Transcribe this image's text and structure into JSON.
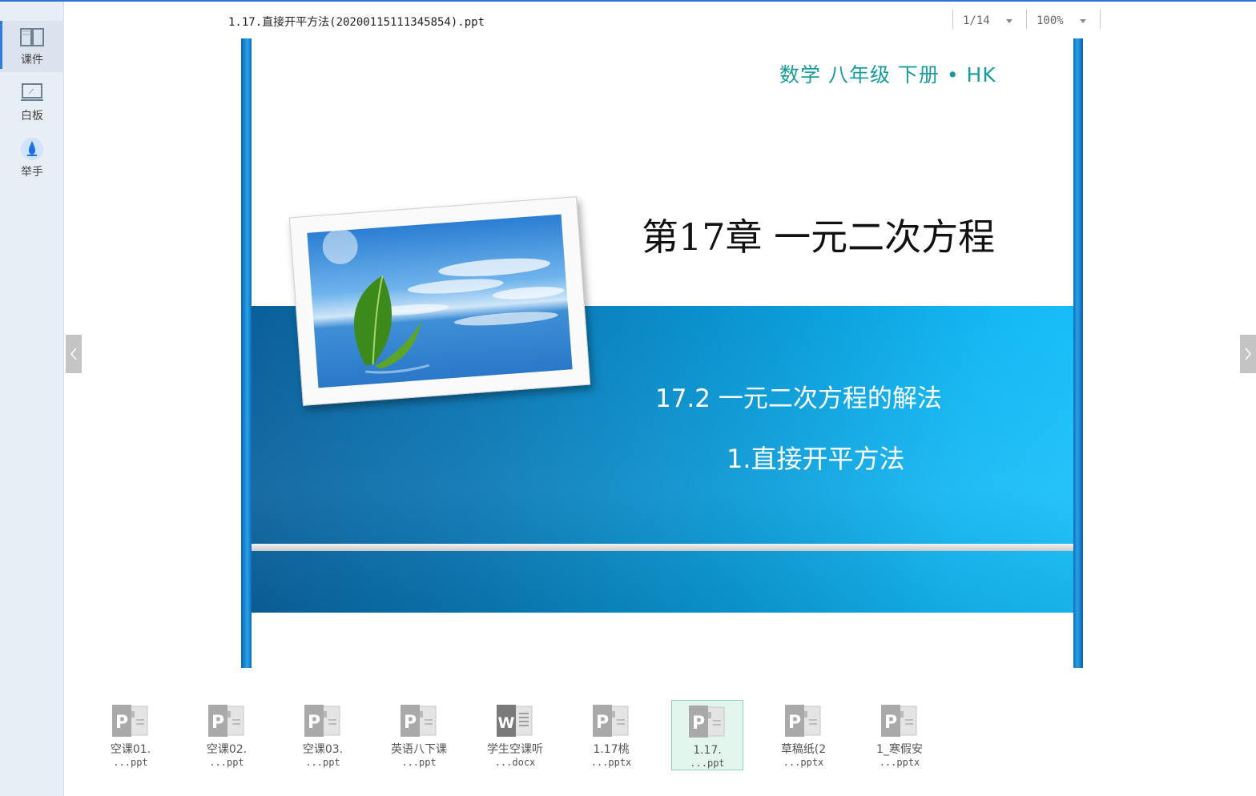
{
  "sidebar": {
    "items": [
      {
        "label": "课件",
        "icon": "book-icon"
      },
      {
        "label": "白板",
        "icon": "whiteboard-icon"
      },
      {
        "label": "举手",
        "icon": "raise-hand-icon"
      }
    ]
  },
  "header": {
    "file_title": "1.17.直接开平方法(20200115111345854).ppt",
    "page_indicator": "1/14",
    "zoom": "100%"
  },
  "slide": {
    "subject": "数学   八年级   下册 • HK",
    "chapter": "第17章    一元二次方程",
    "section": "17.2    一元二次方程的解法",
    "lesson": "1.直接开平方法"
  },
  "files": [
    {
      "name": "空课01.",
      "ext": "...ppt",
      "type": "P"
    },
    {
      "name": "空课02.",
      "ext": "...ppt",
      "type": "P"
    },
    {
      "name": "空课03.",
      "ext": "...ppt",
      "type": "P"
    },
    {
      "name": "英语八下课",
      "ext": "...ppt",
      "type": "P"
    },
    {
      "name": "学生空课听",
      "ext": "...docx",
      "type": "W"
    },
    {
      "name": "1.17桃",
      "ext": "...pptx",
      "type": "P"
    },
    {
      "name": "1.17.",
      "ext": "...ppt",
      "type": "P"
    },
    {
      "name": "草稿纸(2",
      "ext": "...pptx",
      "type": "P"
    },
    {
      "name": "1_寒假安",
      "ext": "...pptx",
      "type": "P"
    }
  ],
  "colors": {
    "accent": "#2f7ce0",
    "subject_text": "#1a9c9e",
    "active_file_bg": "#e3f6ee"
  }
}
